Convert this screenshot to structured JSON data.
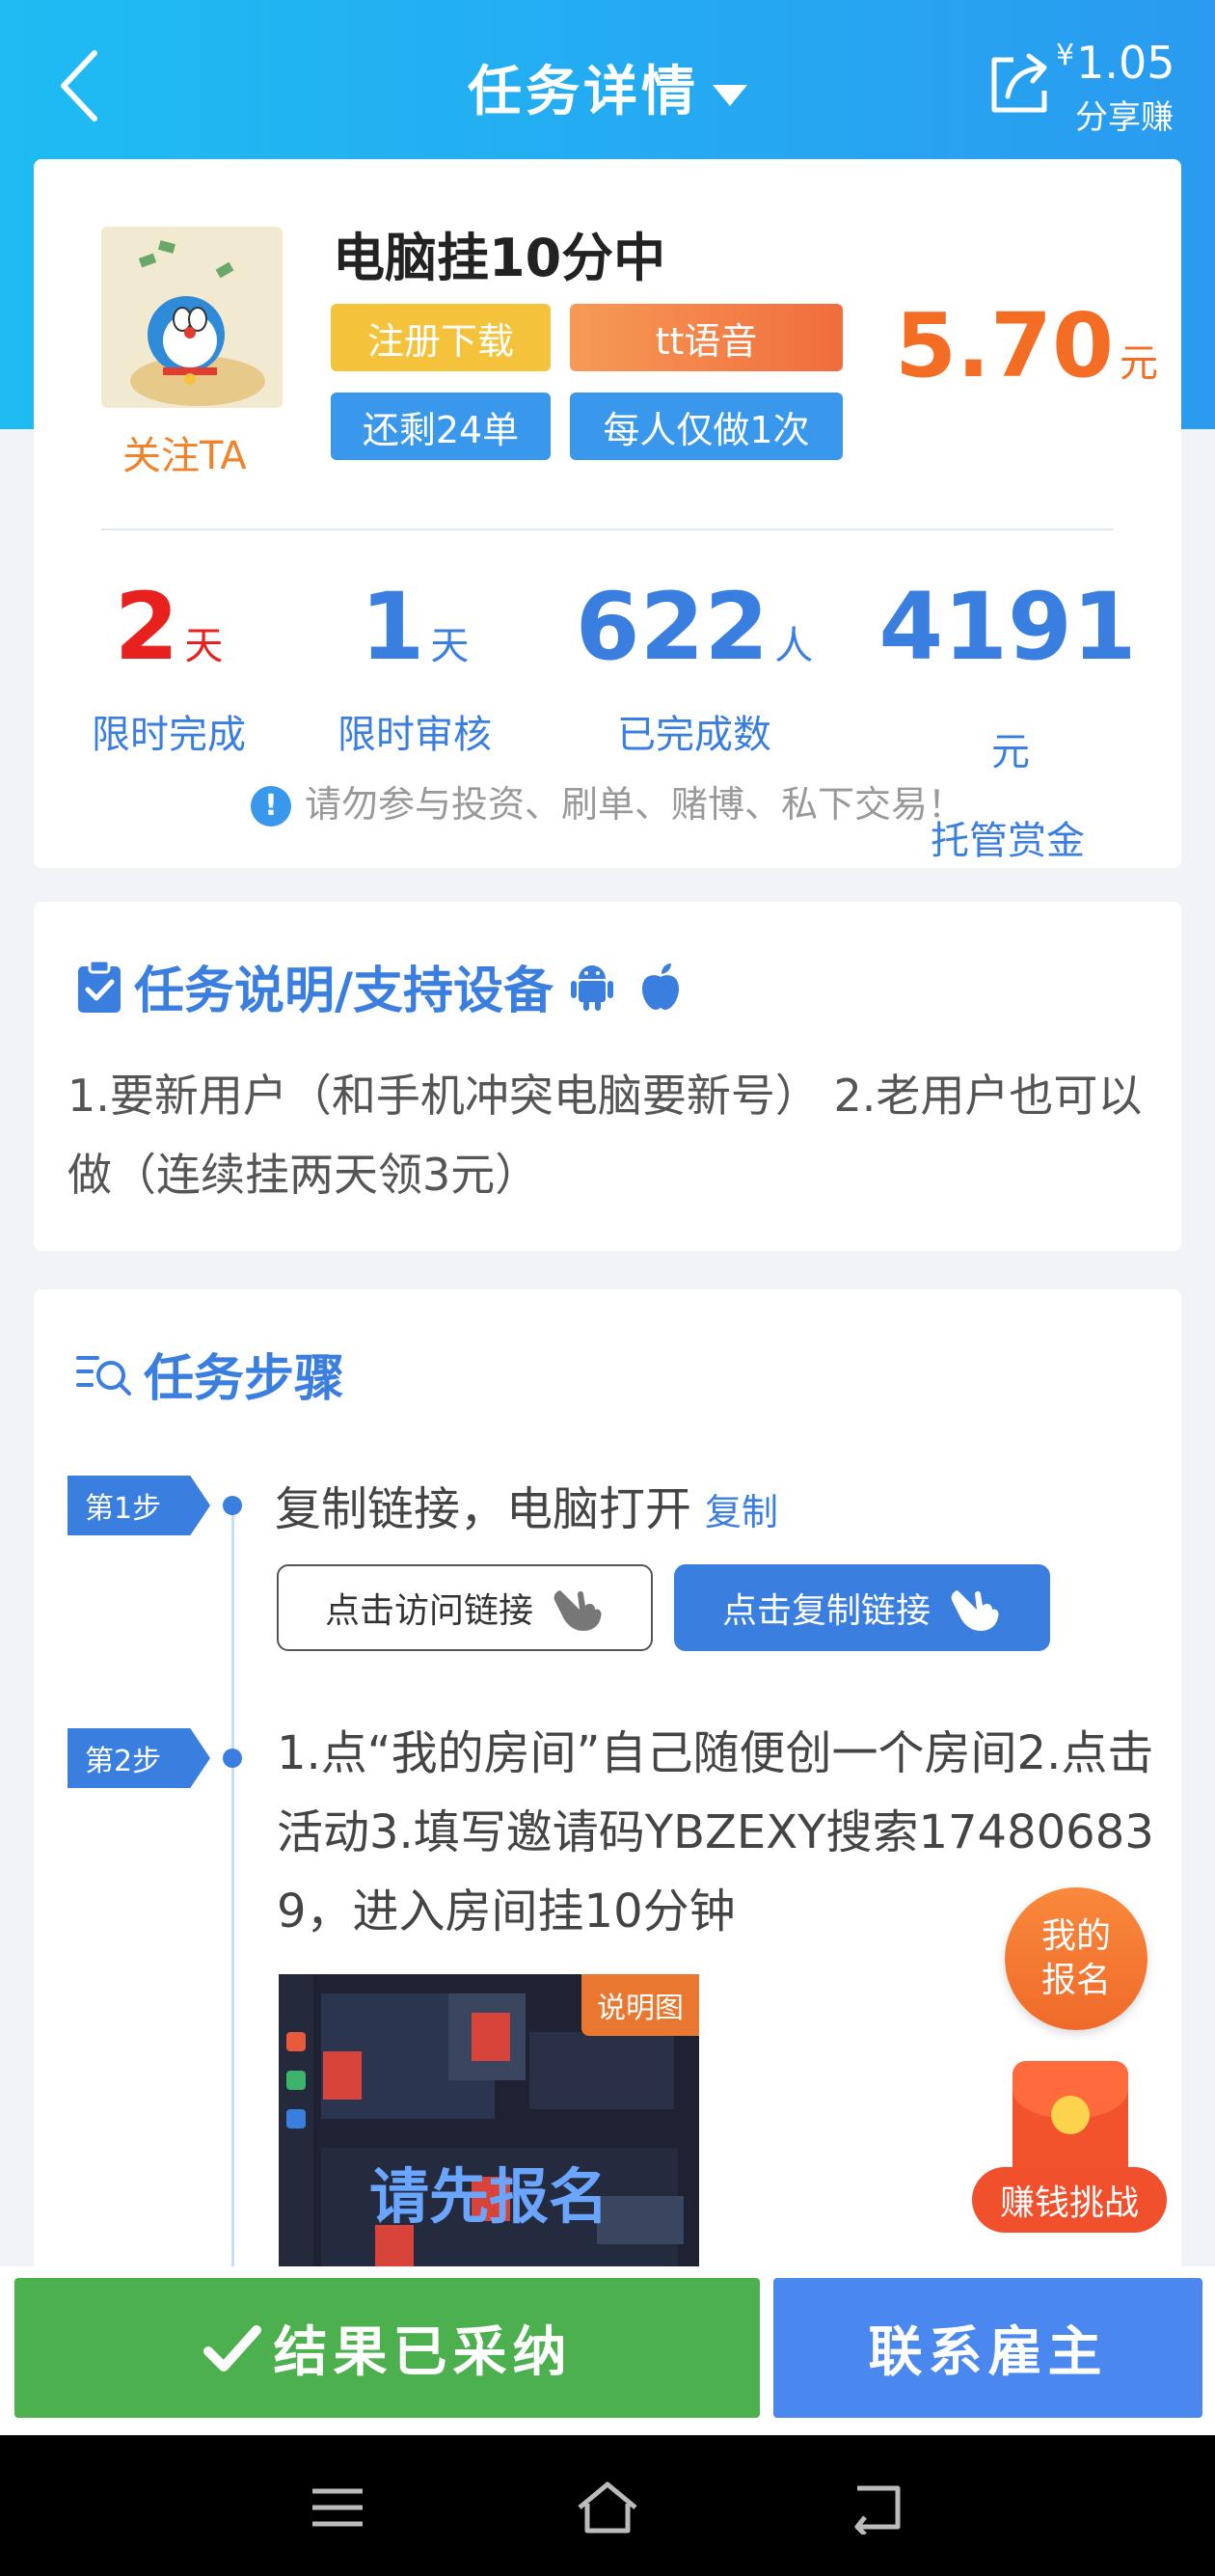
{
  "topbar": {
    "title": "任务详情",
    "share_amount": "1.05",
    "share_currency": "¥",
    "share_label": "分享赚"
  },
  "task": {
    "title": "电脑挂10分中",
    "follow_label": "关注TA",
    "tags": [
      "注册下载",
      "tt语音",
      "还剩24单",
      "每人仅做1次"
    ],
    "price": "5.70",
    "price_unit": "元"
  },
  "stats": [
    {
      "value": "2",
      "unit": "天",
      "label": "限时完成"
    },
    {
      "value": "1",
      "unit": "天",
      "label": "限时审核"
    },
    {
      "value": "622",
      "unit": "人",
      "label": "已完成数"
    },
    {
      "value": "4191",
      "unit": "元",
      "label": "托管赏金"
    }
  ],
  "warning": "请勿参与投资、刷单、赌博、私下交易！",
  "description": {
    "title": "任务说明/支持设备",
    "text": "1.要新用户（和手机冲突电脑要新号） 2.老用户也可以做（连续挂两天领3元）"
  },
  "steps": {
    "title": "任务步骤",
    "step1": {
      "badge": "第1步",
      "text": "复制链接，电脑打开",
      "copy_label": "复制",
      "visit_button": "点击访问链接",
      "copy_button": "点击复制链接"
    },
    "step2": {
      "badge": "第2步",
      "text": "1.点“我的房间”自己随便创一个房间2.点击活动3.填写邀请码YBZEXY搜索174806839，进入房间挂10分钟",
      "image_tag": "说明图",
      "image_overlay": "请先报名"
    }
  },
  "floating": {
    "enroll": "我的报名",
    "enroll_line1": "我的",
    "enroll_line2": "报名",
    "challenge": "赚钱挑战"
  },
  "bottom": {
    "accepted": "结果已采纳",
    "contact": "联系雇主"
  },
  "colors": {
    "header_start": "#1ebcf3",
    "header_end": "#2a9bf0",
    "accent_blue": "#3a7fe0",
    "price_orange": "#f36d24",
    "accepted_green": "#4bb04d",
    "contact_blue": "#4a87ee"
  }
}
